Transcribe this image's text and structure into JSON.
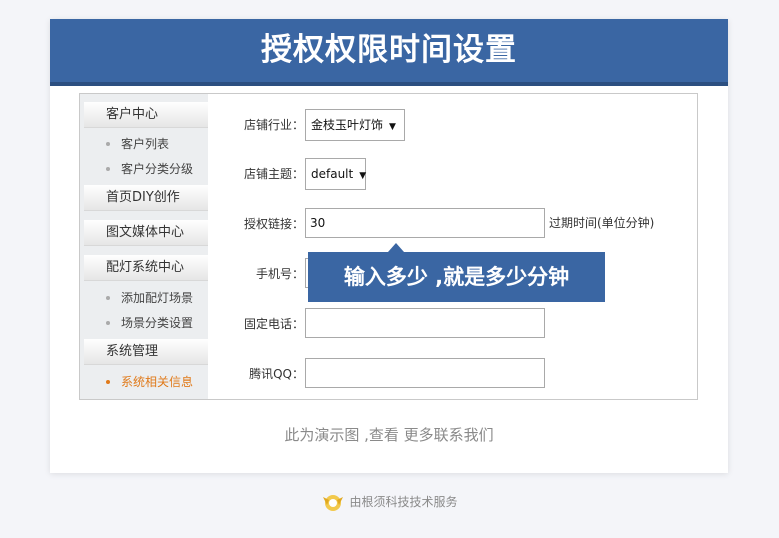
{
  "header": {
    "title": "授权权限时间设置"
  },
  "sidebar": {
    "groups": [
      {
        "label": "客户中心",
        "items": [
          "客户列表",
          "客户分类分级"
        ]
      },
      {
        "label": "首页DIY创作",
        "items": []
      },
      {
        "label": "图文媒体中心",
        "items": []
      },
      {
        "label": "配灯系统中心",
        "items": [
          "添加配灯场景",
          "场景分类设置"
        ]
      },
      {
        "label": "系统管理",
        "items": [
          "系统相关信息"
        ]
      }
    ],
    "active_item": "系统相关信息"
  },
  "form": {
    "industry": {
      "label": "店铺行业：",
      "value": "金枝玉叶灯饰"
    },
    "theme": {
      "label": "店铺主题：",
      "value": "default"
    },
    "auth": {
      "label": "授权链接：",
      "value": "30",
      "hint": "过期时间(单位分钟)"
    },
    "mobile": {
      "label": "手机号：",
      "value": ""
    },
    "phone": {
      "label": "固定电话：",
      "value": ""
    },
    "qq": {
      "label": "腾讯QQ：",
      "value": ""
    }
  },
  "tooltip": {
    "text": "输入多少 ,就是多少分钟"
  },
  "demo_note": "此为演示图 ,查看 更多联系我们",
  "footer": {
    "text": "由根须科技技术服务"
  },
  "colors": {
    "brand": "#3a66a3",
    "active": "#e07a1a"
  }
}
